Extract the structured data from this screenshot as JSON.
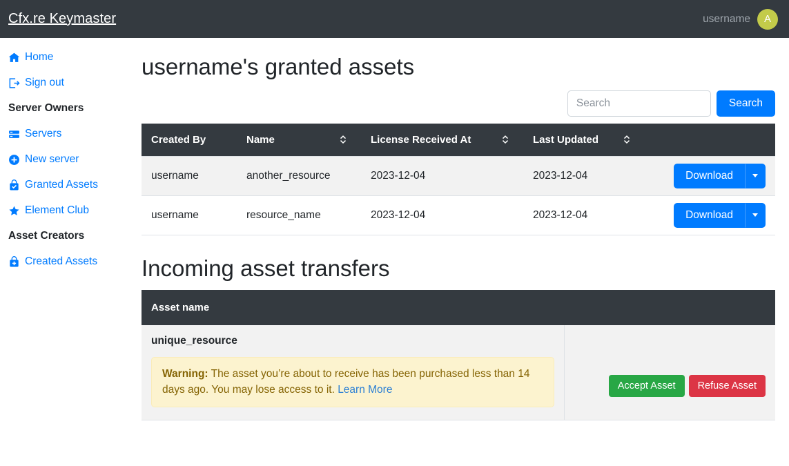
{
  "navbar": {
    "brand": "Cfx.re Keymaster",
    "username": "username",
    "avatar_initial": "A",
    "avatar_color": "#c3cb4a",
    "background": "#343a40"
  },
  "sidebar": {
    "items": [
      {
        "type": "link",
        "label": "Home",
        "icon": "home-icon"
      },
      {
        "type": "link",
        "label": "Sign out",
        "icon": "sign-out-icon"
      },
      {
        "type": "heading",
        "label": "Server Owners"
      },
      {
        "type": "link",
        "label": "Servers",
        "icon": "server-icon"
      },
      {
        "type": "link",
        "label": "New server",
        "icon": "plus-circle-icon"
      },
      {
        "type": "link",
        "label": "Granted Assets",
        "icon": "bag-check-icon"
      },
      {
        "type": "link",
        "label": "Element Club",
        "icon": "star-icon"
      },
      {
        "type": "heading",
        "label": "Asset Creators"
      },
      {
        "type": "link",
        "label": "Created Assets",
        "icon": "bag-plus-icon"
      }
    ],
    "link_color": "#007bff"
  },
  "main": {
    "page_title": "username's granted assets",
    "search": {
      "placeholder": "Search",
      "value": "",
      "button_label": "Search",
      "button_color": "#007bff"
    },
    "assets_table": {
      "columns": [
        {
          "label": "Created By",
          "sortable": false
        },
        {
          "label": "Name",
          "sortable": true
        },
        {
          "label": "License Received At",
          "sortable": true
        },
        {
          "label": "Last Updated",
          "sortable": true
        },
        {
          "label": "",
          "sortable": false
        }
      ],
      "rows": [
        {
          "created_by": "username",
          "name": "another_resource",
          "license_received_at": "2023-12-04",
          "last_updated": "2023-12-04",
          "action_label": "Download"
        },
        {
          "created_by": "username",
          "name": "resource_name",
          "license_received_at": "2023-12-04",
          "last_updated": "2023-12-04",
          "action_label": "Download"
        }
      ]
    },
    "transfers_section_title": "Incoming asset transfers",
    "transfers_table": {
      "columns": [
        {
          "label": "Asset name"
        },
        {
          "label": ""
        }
      ],
      "rows": [
        {
          "asset_name": "unique_resource",
          "warning": {
            "prefix": "Warning:",
            "text": " The asset you’re about to receive has been purchased less than 14 days ago. You may lose access to it. ",
            "link_label": "Learn More",
            "background": "#fcf3cf",
            "text_color": "#856404"
          },
          "accept_label": "Accept Asset",
          "refuse_label": "Refuse Asset",
          "accept_color": "#28a745",
          "refuse_color": "#dc3545"
        }
      ]
    }
  }
}
